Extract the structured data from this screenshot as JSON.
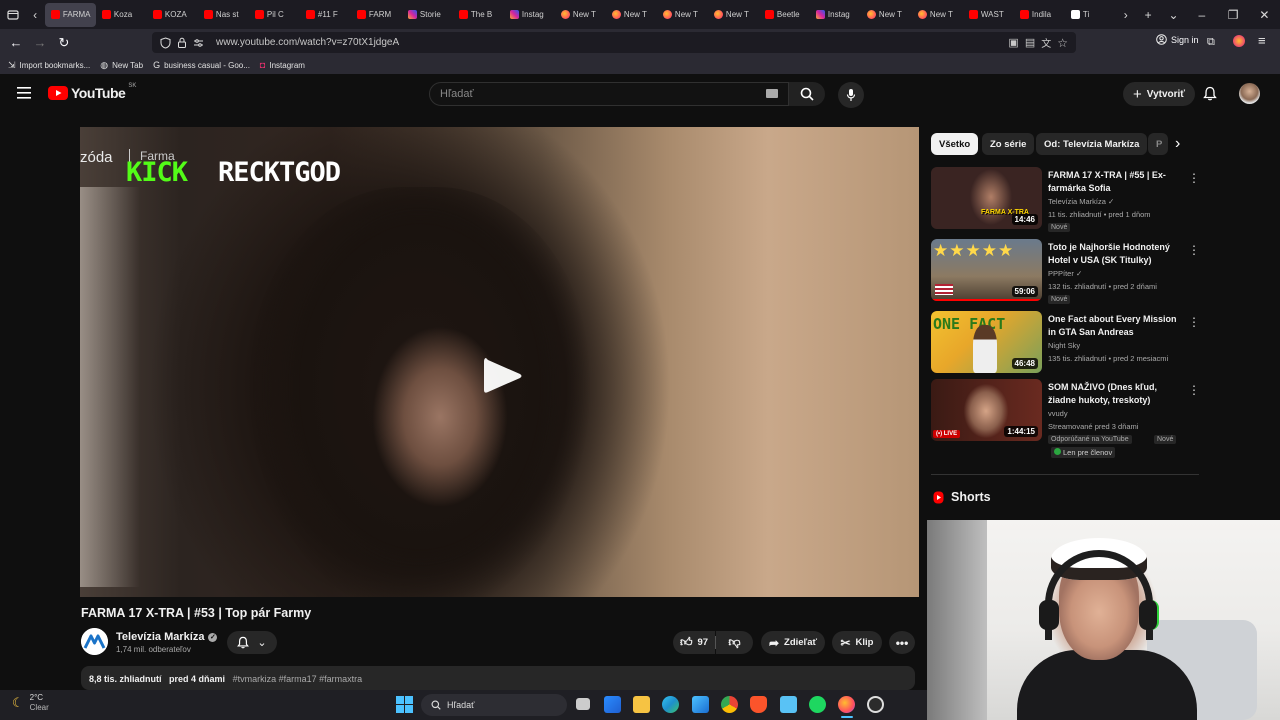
{
  "browser": {
    "tabs": [
      {
        "label": "FARMA",
        "icon": "yt",
        "active": true
      },
      {
        "label": "Koza",
        "icon": "yt"
      },
      {
        "label": "KOZA",
        "icon": "yt"
      },
      {
        "label": "Nas st",
        "icon": "yt"
      },
      {
        "label": "Pil C",
        "icon": "yt"
      },
      {
        "label": "#11 F",
        "icon": "yt"
      },
      {
        "label": "FARM",
        "icon": "yt"
      },
      {
        "label": "Storie",
        "icon": "ig"
      },
      {
        "label": "The B",
        "icon": "yt"
      },
      {
        "label": "Instag",
        "icon": "ig"
      },
      {
        "label": "New T",
        "icon": "ff"
      },
      {
        "label": "New T",
        "icon": "ff"
      },
      {
        "label": "New T",
        "icon": "ff"
      },
      {
        "label": "New T",
        "icon": "ff"
      },
      {
        "label": "Beetle",
        "icon": "yt"
      },
      {
        "label": "Instag",
        "icon": "ig"
      },
      {
        "label": "New T",
        "icon": "ff"
      },
      {
        "label": "New T",
        "icon": "ff"
      },
      {
        "label": "WAST",
        "icon": "yt"
      },
      {
        "label": "Indila",
        "icon": "yt"
      },
      {
        "label": "Ti",
        "icon": "tt"
      }
    ],
    "url": "www.youtube.com/watch?v=z70tX1jdgeA",
    "signin_label": "Sign in",
    "bookmarks": [
      {
        "label": "Import bookmarks...",
        "icon": "import-icon"
      },
      {
        "label": "New Tab",
        "icon": "globe-icon"
      },
      {
        "label": "business casual - Goo...",
        "icon": "google-icon"
      },
      {
        "label": "Instagram",
        "icon": "instagram-icon"
      }
    ]
  },
  "yt": {
    "logo_text": "YouTube",
    "region": "SK",
    "search_placeholder": "Hľadať",
    "create_label": "Vytvoriť"
  },
  "player": {
    "overlay_left": "zóda",
    "overlay_right": "Farma",
    "kick_word": "KICK",
    "streamer_name": "RECKTGOD"
  },
  "video": {
    "title": "FARMA 17 X-TRA | #53 | Top pár Farmy",
    "channel": "Televízia Markíza",
    "subscribers": "1,74 mil. odberateľov",
    "likes": "97",
    "share_label": "Zdieľať",
    "clip_label": "Klip",
    "views": "8,8 tis. zhliadnutí",
    "age": "pred 4 dňami",
    "tags": "#tvmarkiza #farma17 #farmaxtra"
  },
  "chips": [
    "Všetko",
    "Zo série",
    "Od: Televízia Markíza",
    "P"
  ],
  "recommendations": [
    {
      "title": "FARMA 17 X-TRA | #55 | Ex-farmárka Sofia",
      "channel": "Televízia Markíza",
      "meta": "11 tis. zhliadnutí • pred 1 dňom",
      "badges": [
        "Nové"
      ],
      "duration": "14:46",
      "thumb_text": "FARMA X-TRA",
      "verified": true
    },
    {
      "title": "Toto je Najhoršie Hodnotený Hotel v USA (SK Titulky)",
      "channel": "PPPíter",
      "meta": "132 tis. zhliadnutí • pred 2 dňami",
      "badges": [
        "Nové"
      ],
      "duration": "59:06",
      "thumb_text": "★★★★★",
      "verified": true
    },
    {
      "title": "One Fact about Every Mission in GTA San Andreas",
      "channel": "Night Sky",
      "meta": "135 tis. zhliadnutí • pred 2 mesiacmi",
      "badges": [],
      "duration": "46:48",
      "thumb_text": "ONE FACT",
      "verified": false
    },
    {
      "title": "SOM NAŽIVO (Dnes kľud, žiadne hukoty, treskoty)",
      "channel": "vvudy",
      "meta": "Streamované pred 3 dňami",
      "badges": [
        "Odporúčané na YouTube",
        "Nové"
      ],
      "duration": "1:44:15",
      "live_label": "LIVE",
      "members": "Len pre členov",
      "thumb_text": "",
      "verified": false
    }
  ],
  "shorts_label": "Shorts",
  "taskbar": {
    "temp": "2°C",
    "condition": "Clear",
    "search_label": "Hľadať"
  },
  "colors": {
    "yt_red": "#ff0000",
    "kick_green": "#53fc18",
    "bg": "#0f0f0f"
  }
}
